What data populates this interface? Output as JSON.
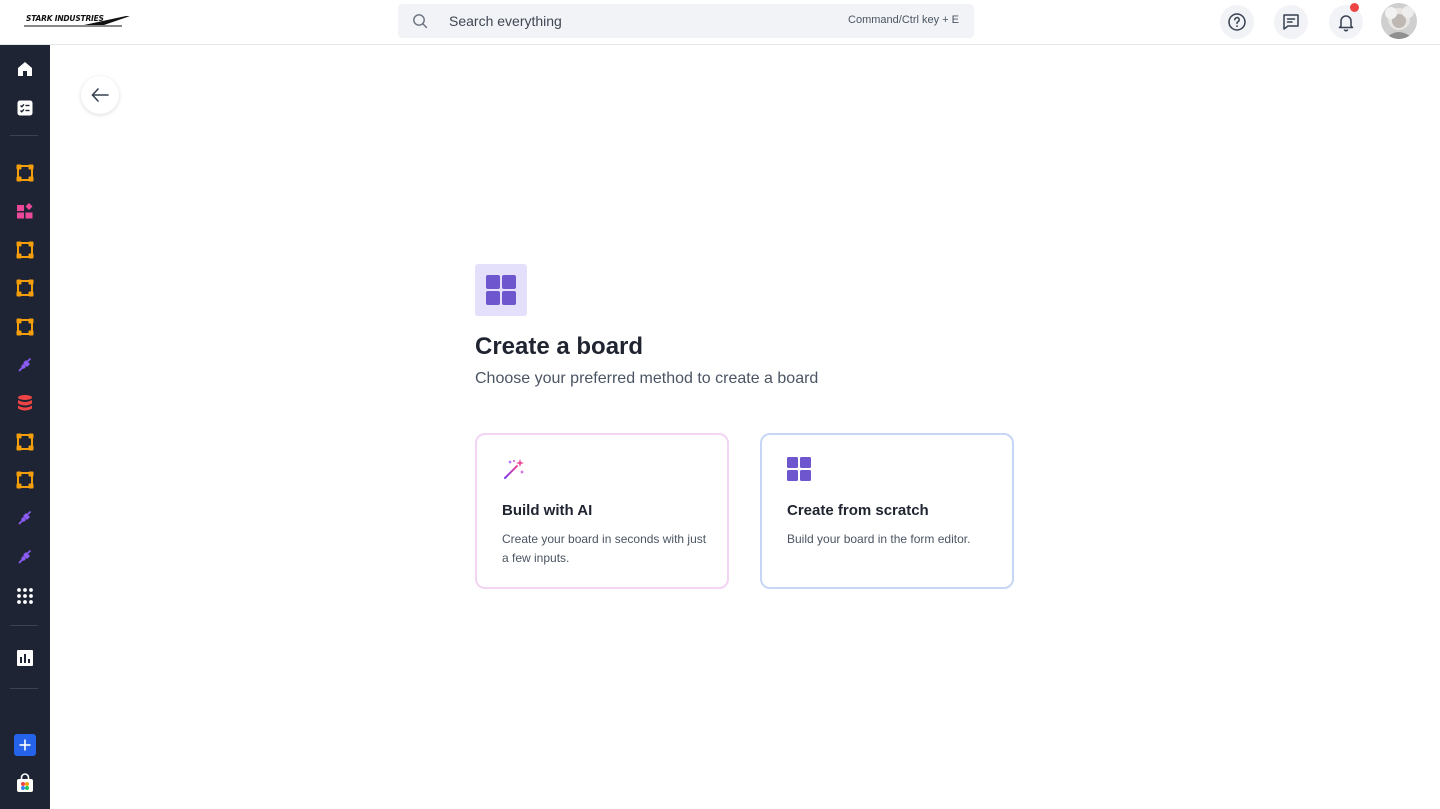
{
  "header": {
    "logo_text": "STARK INDUSTRIES",
    "search": {
      "placeholder": "Search everything",
      "shortcut": "Command/Ctrl key + E"
    },
    "icons": [
      "help-icon",
      "feedback-icon",
      "bell-icon"
    ],
    "has_notification": true
  },
  "sidebar": {
    "items": [
      {
        "icon": "home-icon"
      },
      {
        "icon": "tasks-icon"
      },
      {
        "icon": "workflow-icon",
        "color": "#f59e0b"
      },
      {
        "icon": "apps-icon",
        "color": "#ec4899"
      },
      {
        "icon": "workflow-icon",
        "color": "#f59e0b"
      },
      {
        "icon": "workflow-icon",
        "color": "#f59e0b"
      },
      {
        "icon": "workflow-icon",
        "color": "#f59e0b"
      },
      {
        "icon": "plug-icon",
        "color": "#8b5cf6"
      },
      {
        "icon": "database-icon",
        "color": "#ef4444"
      },
      {
        "icon": "workflow-icon",
        "color": "#f59e0b"
      },
      {
        "icon": "workflow-icon",
        "color": "#f59e0b"
      },
      {
        "icon": "plug-icon",
        "color": "#8b5cf6"
      },
      {
        "icon": "plug-icon",
        "color": "#8b5cf6"
      },
      {
        "icon": "grid-dots-icon"
      },
      {
        "icon": "chart-icon"
      },
      {
        "icon": "add-icon",
        "color": "#2563eb"
      },
      {
        "icon": "store-icon"
      }
    ]
  },
  "main": {
    "title": "Create a board",
    "subtitle": "Choose your preferred method to create a board",
    "cards": [
      {
        "title": "Build with AI",
        "description": "Create your board in seconds with just a few inputs.",
        "icon": "magic-wand-icon"
      },
      {
        "title": "Create from scratch",
        "description": "Build your board in the form editor.",
        "icon": "board-grid-icon"
      }
    ]
  },
  "colors": {
    "accent": "#6e56cf",
    "sidebar_bg": "#1e2433",
    "notification": "#ef4444"
  }
}
